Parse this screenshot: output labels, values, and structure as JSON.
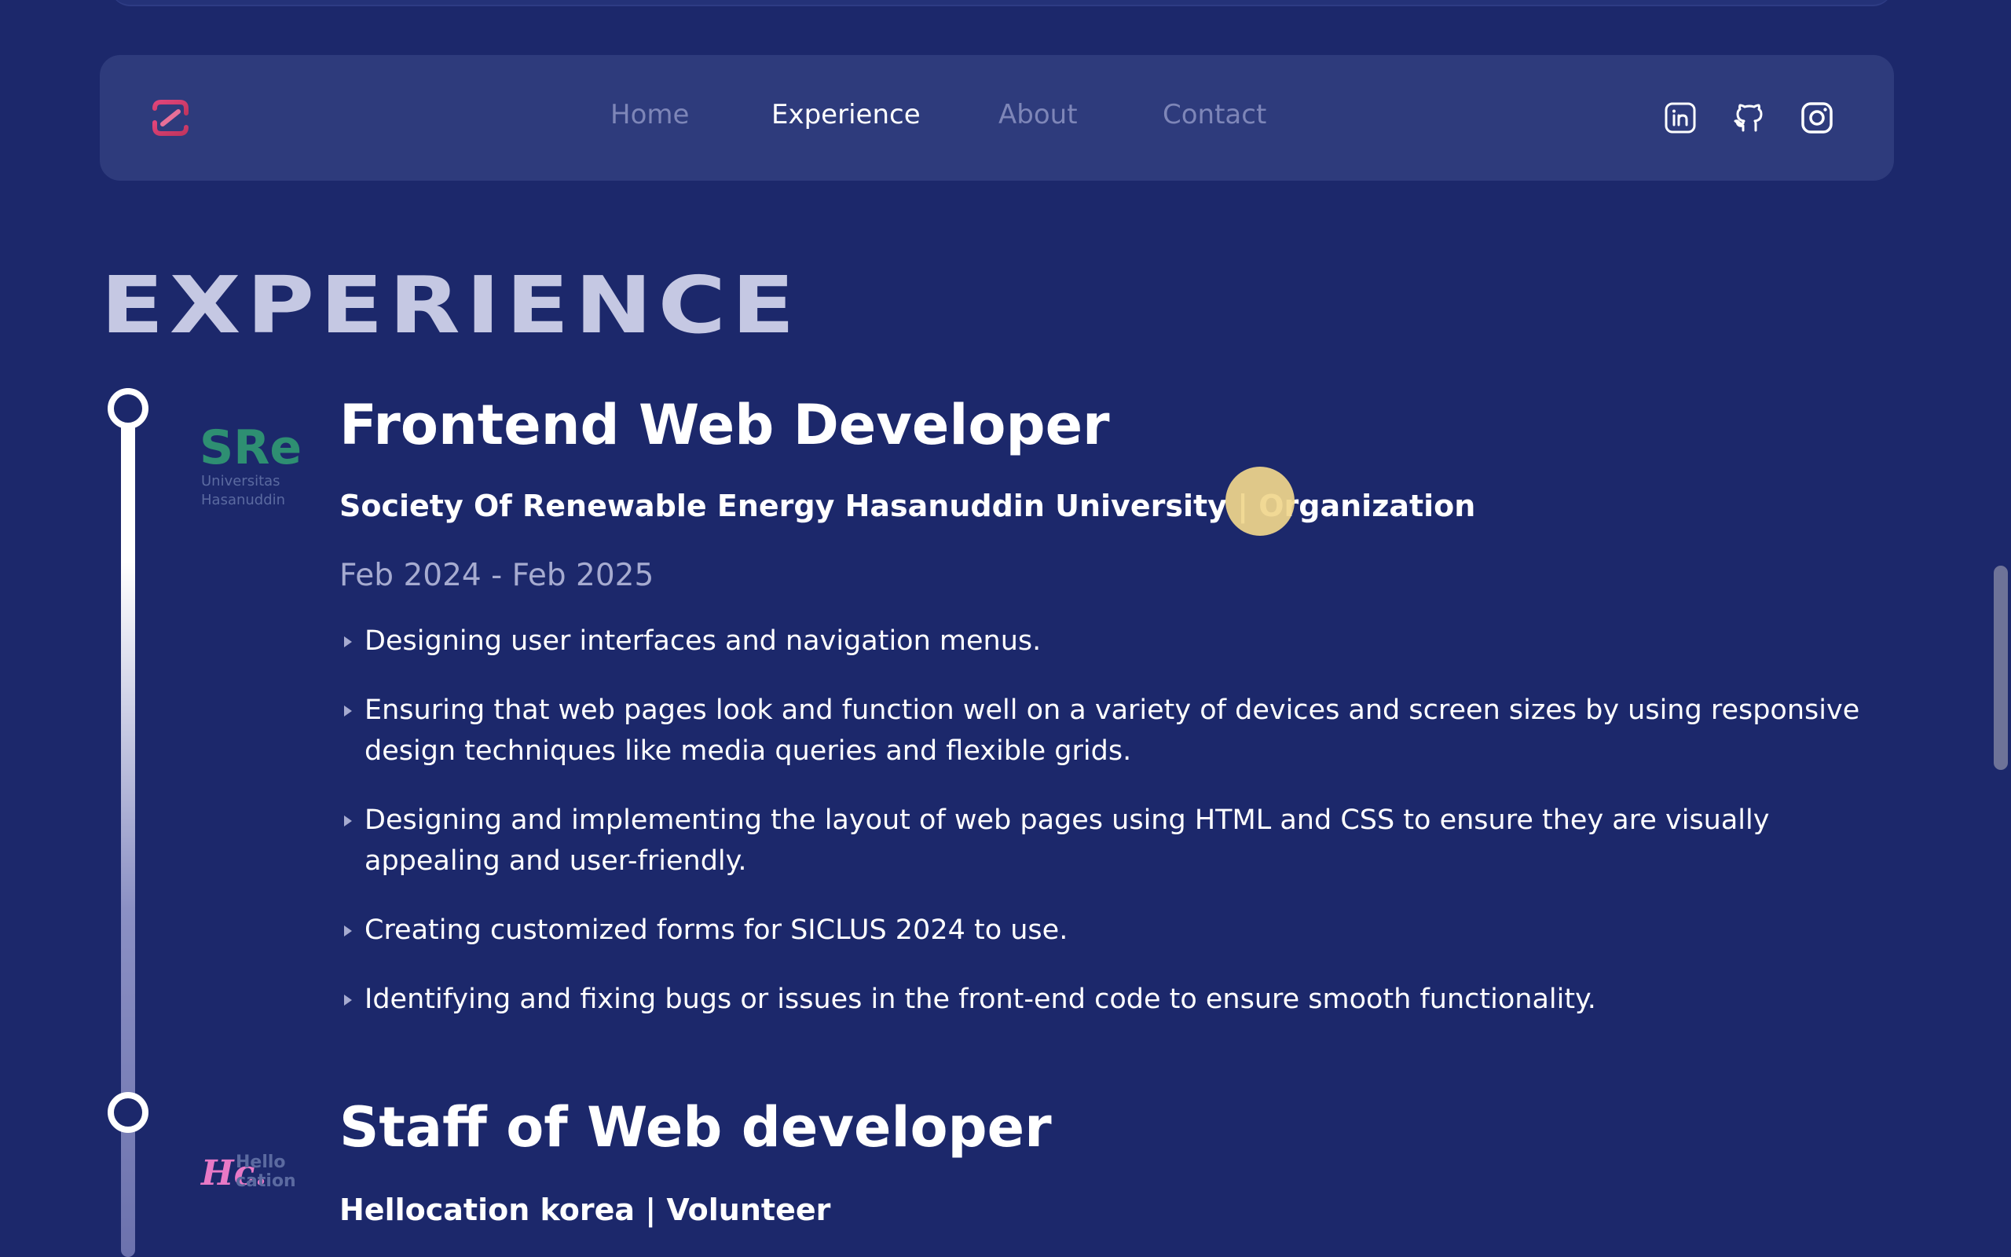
{
  "nav": {
    "logo_icon": "brand-logo-icon",
    "links": [
      "Home",
      "Experience",
      "About",
      "Contact"
    ],
    "active": "Experience",
    "social_icons": [
      "linkedin-icon",
      "github-icon",
      "instagram-icon"
    ]
  },
  "section": {
    "title": "EXPERIENCE"
  },
  "experiences": [
    {
      "title": "Frontend Web Developer",
      "organization": "Society Of Renewable Energy Hasanuddin University | Organization",
      "date": "Feb 2024 - Feb 2025",
      "logo": {
        "text": "SRe",
        "subtitle_line1": "Universitas",
        "subtitle_line2": "Hasanuddin",
        "color": "#2e8f72"
      },
      "bullets": [
        "Designing user interfaces and navigation menus.",
        "Ensuring that web pages look and function well on a variety of devices and screen sizes by using responsive design techniques like media queries and flexible grids.",
        "Designing and implementing the layout of web pages using HTML and CSS to ensure they are visually appealing and user-friendly.",
        "Creating customized forms for SICLUS 2024 to use.",
        "Identifying and fixing bugs or issues in the front-end code to ensure smooth functionality."
      ]
    },
    {
      "title": "Staff of Web developer",
      "organization": "Hellocation korea | Volunteer",
      "logo": {
        "mark": "Hc.",
        "line1": "Hello",
        "line2": "cation",
        "color": "#e879c6"
      }
    }
  ],
  "colors": {
    "background": "#1c286b",
    "navbar": "#2e3b7c",
    "accent_cursor": "#f0d68c",
    "muted_text": "#a6abd0"
  }
}
